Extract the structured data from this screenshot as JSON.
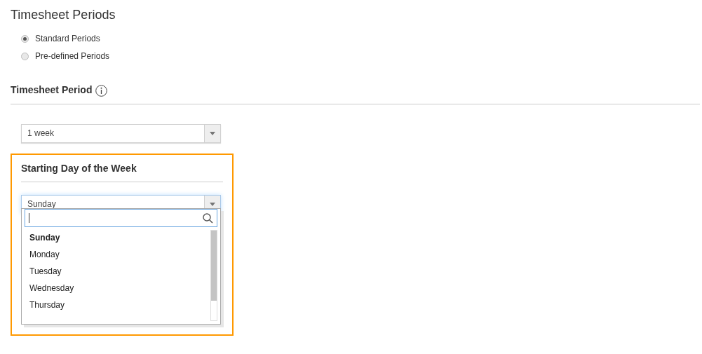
{
  "title": "Timesheet Periods",
  "period_types": [
    {
      "label": "Standard Periods",
      "selected": true
    },
    {
      "label": "Pre-defined Periods",
      "selected": false
    }
  ],
  "timesheet_period": {
    "heading": "Timesheet Period",
    "value": "1 week"
  },
  "starting_day": {
    "heading": "Starting Day of the Week",
    "value": "Sunday",
    "expanded": true,
    "options": [
      {
        "label": "Sunday",
        "selected": true
      },
      {
        "label": "Monday",
        "selected": false
      },
      {
        "label": "Tuesday",
        "selected": false
      },
      {
        "label": "Wednesday",
        "selected": false
      },
      {
        "label": "Thursday",
        "selected": false
      }
    ]
  }
}
